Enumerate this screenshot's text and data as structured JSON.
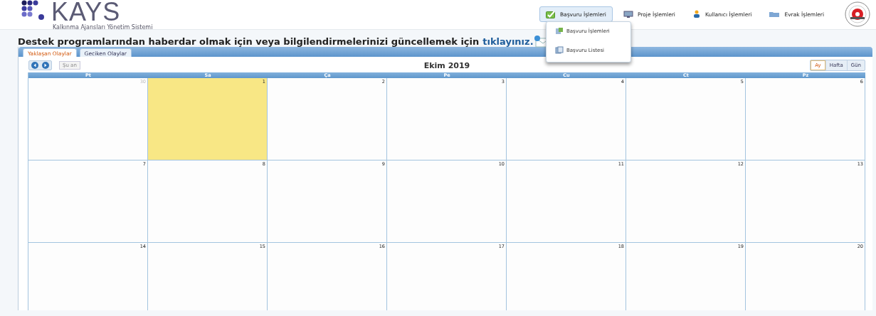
{
  "logo": {
    "title": "KAYS",
    "subtitle": "Kalkınma Ajansları Yönetim Sistemi"
  },
  "nav": [
    {
      "label": "Başvuru İşlemleri",
      "selected": true
    },
    {
      "label": "Proje İşlemleri",
      "selected": false
    },
    {
      "label": "Kullanıcı İşlemleri",
      "selected": false
    },
    {
      "label": "Evrak İşlemleri",
      "selected": false
    }
  ],
  "dropdown": [
    {
      "label": "Başvuru İşlemleri"
    },
    {
      "label": "Başvuru Listesi"
    }
  ],
  "notice": {
    "text": "Destek programlarından haberdar olmak için veya bilgilendirmelerinizi güncellemek için",
    "link": "tıklayınız."
  },
  "tabs": [
    {
      "label": "Yaklaşan Olaylar",
      "selected": true
    },
    {
      "label": "Geciken Olaylar",
      "selected": false
    }
  ],
  "calendar": {
    "title": "Ekim 2019",
    "today_button": {
      "label": "Şu an",
      "disabled": true
    },
    "views": [
      {
        "label": "Ay",
        "selected": true
      },
      {
        "label": "Hafta",
        "selected": false
      },
      {
        "label": "Gün",
        "selected": false
      }
    ],
    "weekdays": [
      "Pt",
      "Sa",
      "Ça",
      "Pe",
      "Cu",
      "Ct",
      "Pz"
    ],
    "weeks": [
      [
        {
          "day": "30",
          "other_month": true,
          "today": false
        },
        {
          "day": "1",
          "other_month": false,
          "today": true
        },
        {
          "day": "2",
          "other_month": false,
          "today": false
        },
        {
          "day": "3",
          "other_month": false,
          "today": false
        },
        {
          "day": "4",
          "other_month": false,
          "today": false
        },
        {
          "day": "5",
          "other_month": false,
          "today": false
        },
        {
          "day": "6",
          "other_month": false,
          "today": false
        }
      ],
      [
        {
          "day": "7",
          "other_month": false,
          "today": false
        },
        {
          "day": "8",
          "other_month": false,
          "today": false
        },
        {
          "day": "9",
          "other_month": false,
          "today": false
        },
        {
          "day": "10",
          "other_month": false,
          "today": false
        },
        {
          "day": "11",
          "other_month": false,
          "today": false
        },
        {
          "day": "12",
          "other_month": false,
          "today": false
        },
        {
          "day": "13",
          "other_month": false,
          "today": false
        }
      ],
      [
        {
          "day": "14",
          "other_month": false,
          "today": false
        },
        {
          "day": "15",
          "other_month": false,
          "today": false
        },
        {
          "day": "16",
          "other_month": false,
          "today": false
        },
        {
          "day": "17",
          "other_month": false,
          "today": false
        },
        {
          "day": "18",
          "other_month": false,
          "today": false
        },
        {
          "day": "19",
          "other_month": false,
          "today": false
        },
        {
          "day": "20",
          "other_month": false,
          "today": false
        }
      ]
    ]
  }
}
